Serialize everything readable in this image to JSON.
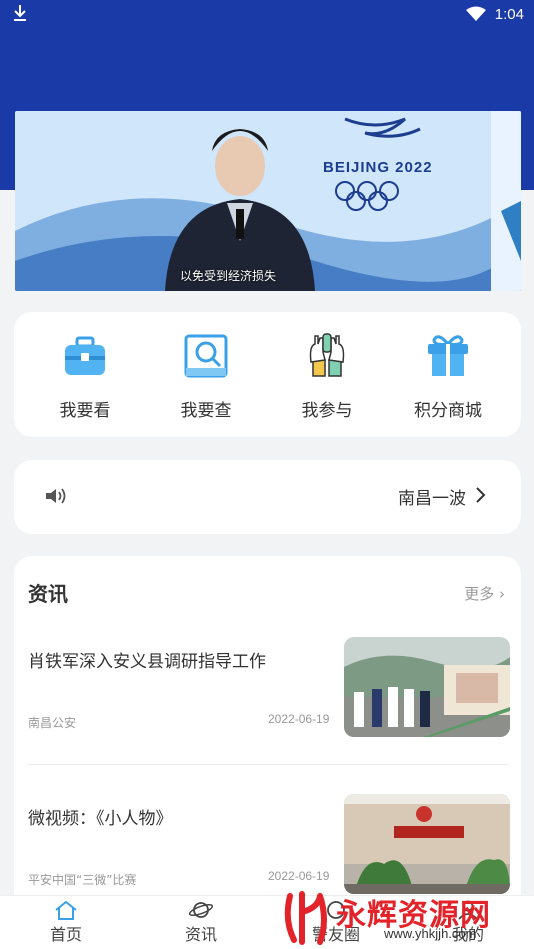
{
  "status_bar": {
    "time": "1:04",
    "download_icon": "download-icon",
    "wifi_icon": "wifi-icon"
  },
  "banner": {
    "brand_text": "BEIJING 2022",
    "caption": "以免受到经济损失"
  },
  "quick_actions": [
    {
      "label": "我要看",
      "icon": "briefcase-icon",
      "color": "#3aa0e8"
    },
    {
      "label": "我要查",
      "icon": "search-doc-icon",
      "color": "#3aa0e8"
    },
    {
      "label": "我参与",
      "icon": "raised-hands-icon",
      "color": "#5fb8a0"
    },
    {
      "label": "积分商城",
      "icon": "gift-icon",
      "color": "#3aa0e8"
    }
  ],
  "notice": {
    "text": "南昌一波",
    "icon": "speaker-icon"
  },
  "news": {
    "heading": "资讯",
    "more": "更多",
    "items": [
      {
        "title": "肖铁军深入安义县调研指导工作",
        "source": "南昌公安",
        "date": "2022-06-19"
      },
      {
        "title": "微视频：《小人物》",
        "source": "平安中国“三微”比赛",
        "date": "2022-06-19"
      }
    ]
  },
  "tabs": [
    {
      "label": "首页",
      "icon": "home-icon"
    },
    {
      "label": "资讯",
      "icon": "planet-icon"
    },
    {
      "label": "警友圈",
      "icon": "circle-icon"
    },
    {
      "label": "我的",
      "icon": "user-icon"
    }
  ],
  "watermark": {
    "text": "永辉资源网",
    "url": "www.yhkjjh.com"
  },
  "colors": {
    "header_blue": "#1a3aa8",
    "accent_blue": "#3aa0e8",
    "watermark_red": "#e2242a"
  }
}
